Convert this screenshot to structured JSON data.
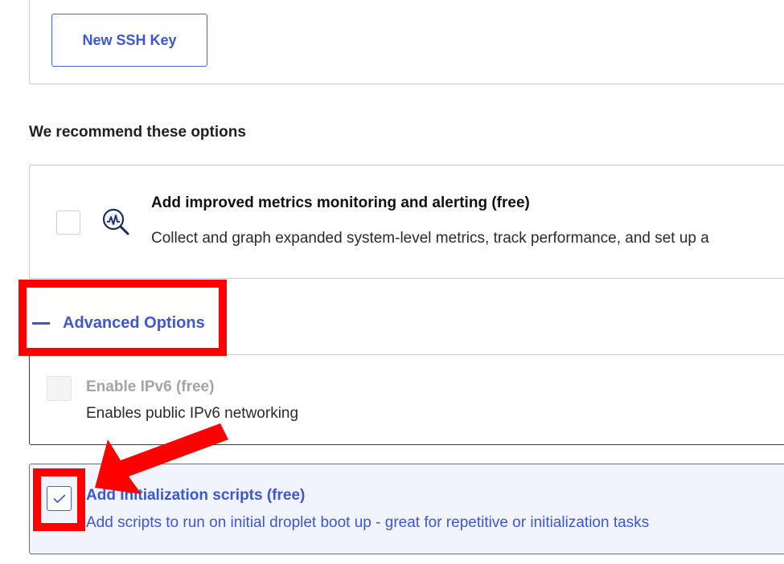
{
  "ssh": {
    "new_key_label": "New SSH Key"
  },
  "recommended": {
    "heading": "We recommend these options",
    "metrics": {
      "icon": "metrics-search-icon",
      "title": "Add improved metrics monitoring and alerting (free)",
      "description": "Collect and graph expanded system-level metrics, track performance, and set up a",
      "checked": false
    }
  },
  "advanced": {
    "toggle_label": "Advanced Options",
    "expanded": true,
    "options": [
      {
        "title": "Enable IPv6 (free)",
        "description": "Enables public IPv6 networking",
        "checked": false,
        "disabled": true
      },
      {
        "title": "Add Initialization scripts (free)",
        "description": "Add scripts to run on initial droplet boot up - great for repetitive or initialization tasks",
        "checked": true,
        "disabled": false
      }
    ]
  },
  "colors": {
    "accent": "#3d57d3",
    "annotation_red": "#ff0000",
    "selected_card_bg": "#f1f4fd"
  }
}
